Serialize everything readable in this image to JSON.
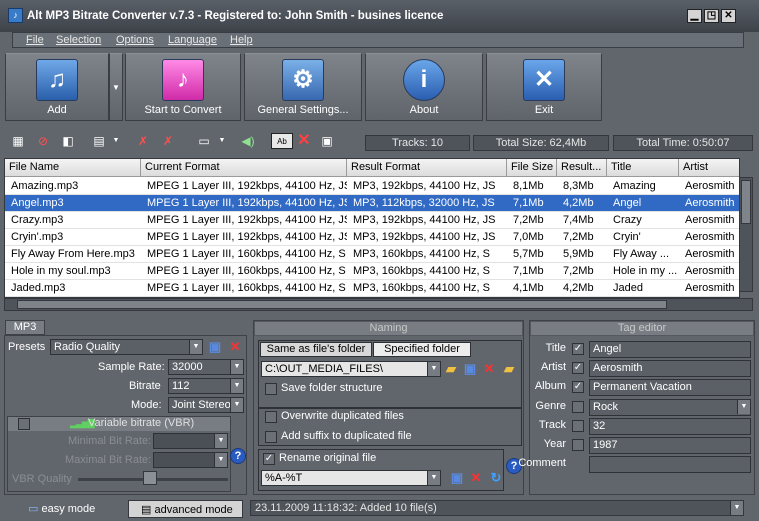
{
  "window": {
    "title": "Alt MP3 Bitrate Converter v.7.3 - Registered to: John Smith - busines licence"
  },
  "menu": [
    "File",
    "Selection",
    "Options",
    "Language",
    "Help"
  ],
  "toolbar": {
    "add": "Add",
    "convert": "Start to Convert",
    "settings": "General Settings...",
    "about": "About",
    "exit": "Exit"
  },
  "stats": {
    "tracks": "Tracks: 10",
    "size": "Total Size: 62,4Mb",
    "time": "Total Time: 0:50:07"
  },
  "table": {
    "headers": [
      "File Name",
      "Current Format",
      "Result Format",
      "File Size",
      "Result...",
      "Title",
      "Artist"
    ],
    "rows": [
      [
        "Amazing.mp3",
        "MPEG 1 Layer III, 192kbps, 44100 Hz, JS",
        "MP3, 192kbps, 44100 Hz, JS",
        "8,1Mb",
        "8,3Mb",
        "Amazing",
        "Aerosmith"
      ],
      [
        "Angel.mp3",
        "MPEG 1 Layer III, 192kbps, 44100 Hz, JS",
        "MP3, 112kbps, 32000 Hz, JS",
        "7,1Mb",
        "4,2Mb",
        "Angel",
        "Aerosmith"
      ],
      [
        "Crazy.mp3",
        "MPEG 1 Layer III, 192kbps, 44100 Hz, JS",
        "MP3, 192kbps, 44100 Hz, JS",
        "7,2Mb",
        "7,4Mb",
        "Crazy",
        "Aerosmith"
      ],
      [
        "Cryin'.mp3",
        "MPEG 1 Layer III, 192kbps, 44100 Hz, JS",
        "MP3, 192kbps, 44100 Hz, JS",
        "7,0Mb",
        "7,2Mb",
        "Cryin'",
        "Aerosmith"
      ],
      [
        "Fly Away From Here.mp3",
        "MPEG 1 Layer III, 160kbps, 44100 Hz, S",
        "MP3, 160kbps, 44100 Hz, S",
        "5,7Mb",
        "5,9Mb",
        "Fly Away ...",
        "Aerosmith"
      ],
      [
        "Hole in my soul.mp3",
        "MPEG 1 Layer III, 160kbps, 44100 Hz, S",
        "MP3, 160kbps, 44100 Hz, S",
        "7,1Mb",
        "7,2Mb",
        "Hole in my ...",
        "Aerosmith"
      ],
      [
        "Jaded.mp3",
        "MPEG 1 Layer III, 160kbps, 44100 Hz, S",
        "MP3, 160kbps, 44100 Hz, S",
        "4,1Mb",
        "4,2Mb",
        "Jaded",
        "Aerosmith"
      ]
    ]
  },
  "mp3panel": {
    "tab": "MP3",
    "presets_label": "Presets",
    "preset": "Radio Quality",
    "sample_rate_label": "Sample Rate:",
    "sample_rate": "32000",
    "bitrate_label": "Bitrate",
    "bitrate": "112",
    "mode_label": "Mode:",
    "mode": "Joint Stereo",
    "vbr_label": "Variable bitrate (VBR)",
    "min_label": "Minimal Bit Rate:",
    "max_label": "Maximal Bit Rate:",
    "quality_label": "VBR Quality"
  },
  "naming": {
    "title": "Naming",
    "tab_same": "Same as file's folder",
    "tab_specified": "Specified folder",
    "folder": "C:\\OUT_MEDIA_FILES\\",
    "save_structure": "Save folder structure",
    "overwrite": "Overwrite duplicated files",
    "add_suffix": "Add suffix to duplicated file",
    "rename": "Rename original file",
    "pattern": "%A-%T"
  },
  "tags": {
    "title": "Tag editor",
    "labels": [
      "Title",
      "Artist",
      "Album",
      "Genre",
      "Track",
      "Year",
      "Comment"
    ],
    "values": [
      "Angel",
      "Aerosmith",
      "Permanent Vacation",
      "Rock",
      "32",
      "1987",
      ""
    ]
  },
  "modes": {
    "easy": "easy mode",
    "advanced": "advanced mode"
  },
  "status": "23.11.2009 11:18:32: Added 10 file(s)",
  "colors": {
    "selection": "#316ac5",
    "convert_button": "#e040c0",
    "panel": "#60666c"
  }
}
